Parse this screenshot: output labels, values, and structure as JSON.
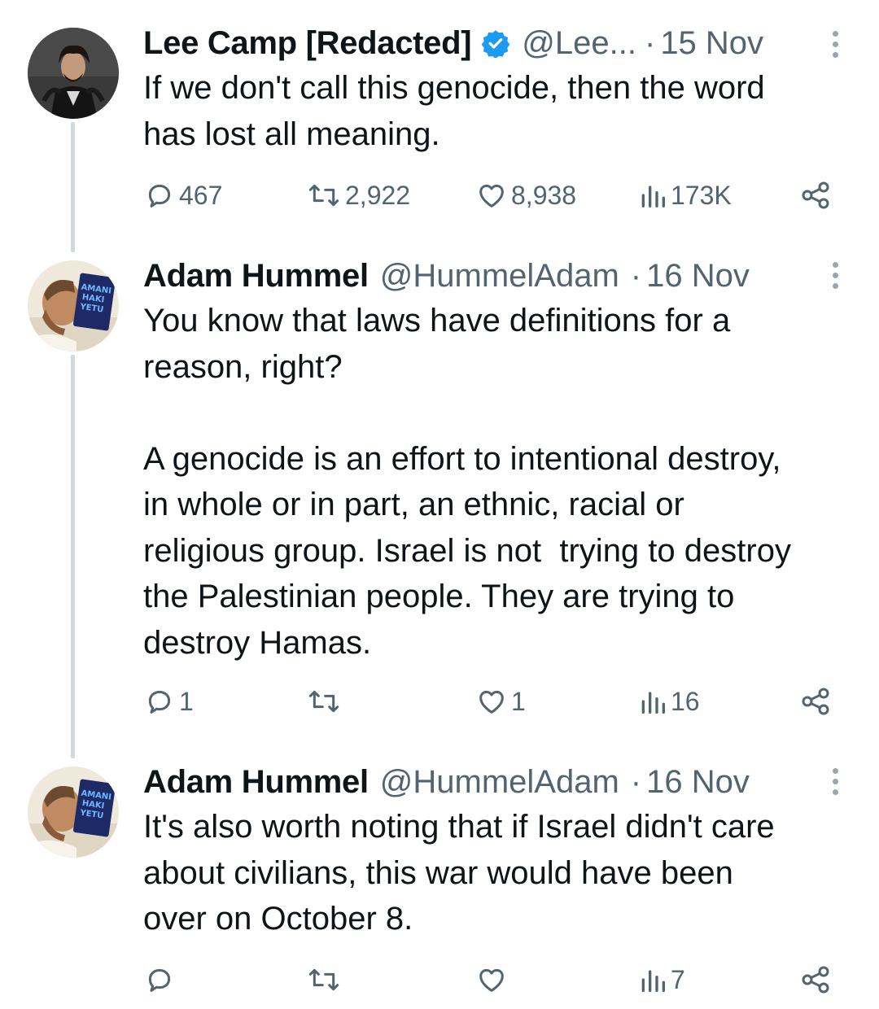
{
  "tweets": [
    {
      "name": "Lee Camp [Redacted]",
      "verified": true,
      "handle": "@Lee...",
      "dot": "·",
      "date": "15 Nov",
      "text": "If we don't call this genocide, then the word\nhas lost all meaning.",
      "replies": "467",
      "retweets": "2,922",
      "likes": "8,938",
      "views": "173K"
    },
    {
      "name": "Adam Hummel",
      "verified": false,
      "handle": "@HummelAdam",
      "dot": "·",
      "date": "16 Nov",
      "text": "You know that laws have definitions for a\nreason, right?\n\nA genocide is an effort to intentional destroy,\nin whole or in part, an ethnic, racial or\nreligious group. Israel is not  trying to destroy\nthe Palestinian people. They are trying to\ndestroy Hamas.",
      "replies": "1",
      "retweets": "",
      "likes": "1",
      "views": "16",
      "avatar_text": "AMANI HAKI YETU"
    },
    {
      "name": "Adam Hummel",
      "verified": false,
      "handle": "@HummelAdam",
      "dot": "·",
      "date": "16 Nov",
      "text": "It's also worth noting that if Israel didn't care\nabout civilians, this war would have been\nover on October 8.",
      "replies": "",
      "retweets": "",
      "likes": "",
      "views": "7",
      "avatar_text": "AMANI HAKI YETU"
    }
  ],
  "colors": {
    "text": "#0f1419",
    "muted": "#536471",
    "verified": "#1d9bf0",
    "thread_line": "#cfd9de"
  }
}
